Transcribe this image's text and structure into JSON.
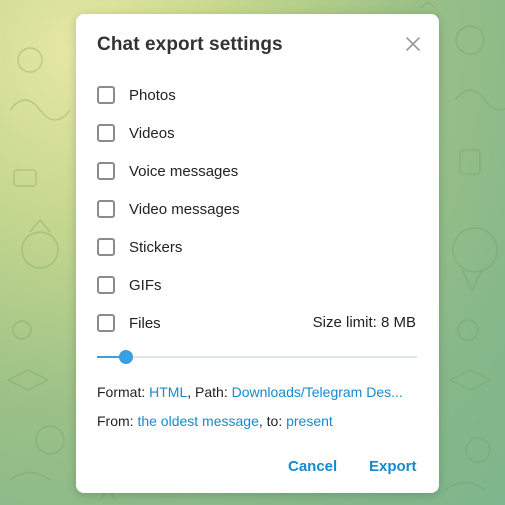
{
  "dialog": {
    "title": "Chat export settings",
    "close_icon": "close-icon"
  },
  "options": [
    {
      "label": "Photos",
      "checked": false
    },
    {
      "label": "Videos",
      "checked": false
    },
    {
      "label": "Voice messages",
      "checked": false
    },
    {
      "label": "Video messages",
      "checked": false
    },
    {
      "label": "Stickers",
      "checked": false
    },
    {
      "label": "GIFs",
      "checked": false
    },
    {
      "label": "Files",
      "checked": false
    }
  ],
  "size_limit": {
    "label": "Size limit: 8 MB",
    "slider_fraction": 0.09
  },
  "format": {
    "prefix": "Format: ",
    "value": "HTML",
    "path_prefix": ", Path: ",
    "path": "Downloads/Telegram Des..."
  },
  "range": {
    "from_prefix": "From: ",
    "from": "the oldest message",
    "to_prefix": ", to: ",
    "to": "present"
  },
  "buttons": {
    "cancel": "Cancel",
    "export": "Export"
  },
  "colors": {
    "accent": "#168acd",
    "slider": "#3a9fe0"
  }
}
